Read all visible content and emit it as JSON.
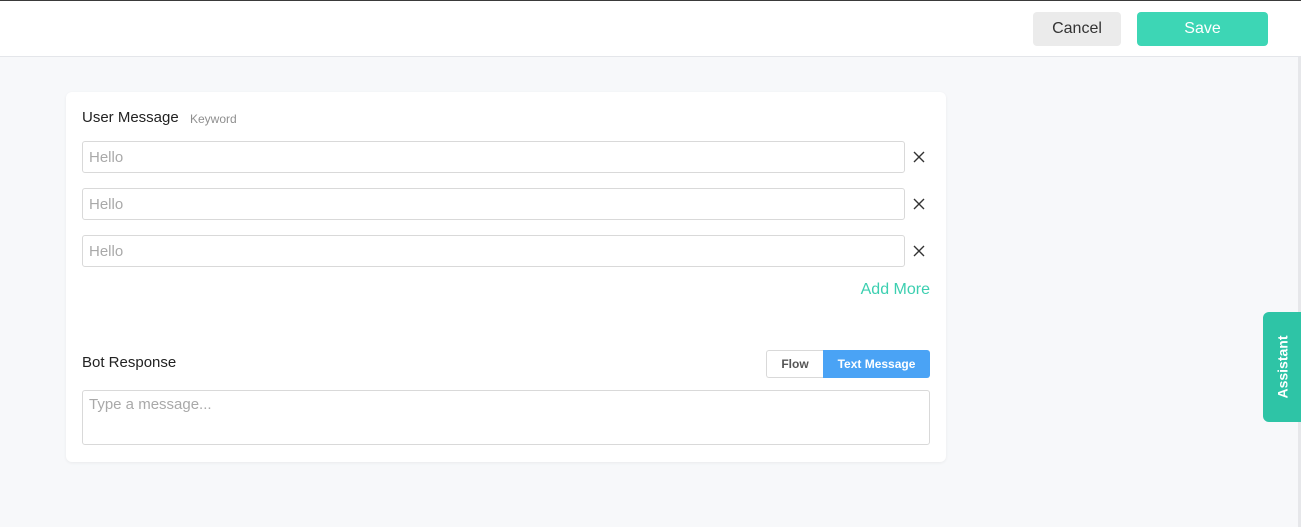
{
  "colors": {
    "accent_green": "#3dd6b5",
    "assistant_green": "#2ec4a6",
    "toggle_blue": "#4aa3f5",
    "link_green": "#3ccfb0"
  },
  "header": {
    "cancel_label": "Cancel",
    "save_label": "Save"
  },
  "user_message": {
    "title": "User Message",
    "sub_label": "Keyword",
    "keywords": [
      {
        "value": "",
        "placeholder": "Hello",
        "remove_icon": "close-icon"
      },
      {
        "value": "",
        "placeholder": "Hello",
        "remove_icon": "close-icon"
      },
      {
        "value": "",
        "placeholder": "Hello",
        "remove_icon": "close-icon"
      }
    ],
    "add_more_label": "Add More"
  },
  "bot_response": {
    "title": "Bot Response",
    "options": [
      "Flow",
      "Text Message"
    ],
    "selected": "Text Message",
    "message_value": "",
    "message_placeholder": "Type a message..."
  },
  "assistant": {
    "label": "Assistant"
  }
}
